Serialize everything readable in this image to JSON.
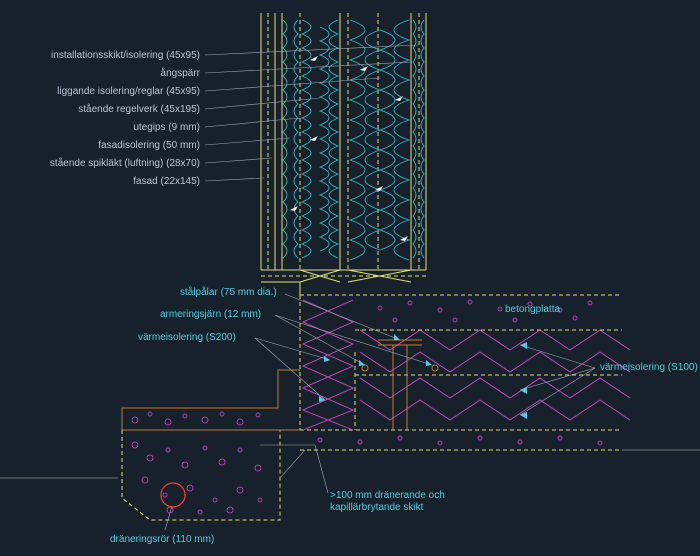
{
  "wall_labels": {
    "l0": "installationsskikt/isolering (45x95)",
    "l1": "ångspärr",
    "l2": "liggande isolering/reglar (45x95)",
    "l3": "stående regelverk (45x195)",
    "l4": "utegips (9 mm)",
    "l5": "fasadisolering (50 mm)",
    "l6": "stående spikläkt (luftning) (28x70)",
    "l7": "fasad (22x145)"
  },
  "foundation_labels": {
    "steel": "stålpålar (75 mm dia.)",
    "rebar": "armeringsjärn (12 mm)",
    "ins_left": "värmeisolering (S200)",
    "ins_right": "värmeisolering (S100)",
    "slab": "betongplatta",
    "drain": "dräneringsrör (110 mm)",
    "gravel": ">100 mm dränerande och",
    "gravel2": "kapillärbrytande skikt"
  }
}
